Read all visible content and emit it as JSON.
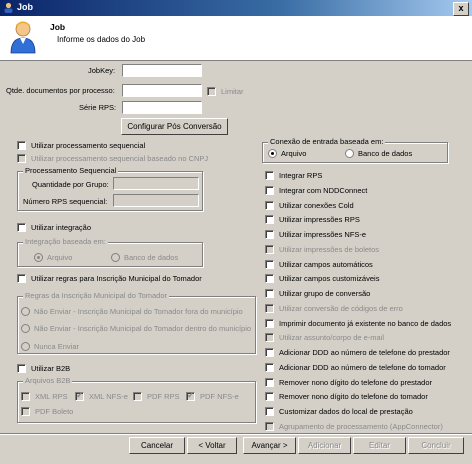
{
  "window": {
    "title": "Job",
    "close_label": "x",
    "title_icon": "user-icon"
  },
  "header": {
    "title": "Job",
    "subtitle": "Informe os dados do Job",
    "icon": "user-avatar-icon"
  },
  "fields": {
    "jobkey_label": "JobKey:",
    "qtd_label": "Qtde. documentos por processo:",
    "limitar_label": "Limitar",
    "serie_label": "Série RPS:",
    "config_button": "Configurar Pós Conversão"
  },
  "left": {
    "proc_seq": "Utilizar processamento sequencial",
    "proc_seq_cnpj": "Utilizar processamento sequencial baseado no CNPJ",
    "grp_proc_seq": "Processamento Sequencial",
    "qtd_grupo": "Quantidade por Grupo:",
    "num_rps_seq": "Número RPS sequencial:",
    "integracao": "Utilizar integração",
    "grp_integracao": "Integração baseada em:",
    "int_arquivo": "Arquivo",
    "int_banco": "Banco de dados",
    "regras_im": "Utilizar regras para Inscrição Municipal do Tomador",
    "grp_regras": "Regras da Inscrição Municipal do Tomador",
    "regra1": "Não Enviar - Inscrição Municipal do Tomador fora do município",
    "regra2": "Não Enviar - Inscrição Municipal do Tomador dentro do município",
    "regra3": "Nunca Enviar",
    "b2b": "Utilizar B2B",
    "grp_b2b": "Arquivos B2B",
    "xml_rps": "XML RPS",
    "xml_nfse": "XML NFS-e",
    "pdf_rps": "PDF RPS",
    "pdf_nfse": "PDF NFS-e",
    "pdf_boleto": "PDF Boleto"
  },
  "right": {
    "grp_conexao": "Conexão de entrada baseada em:",
    "con_arquivo": "Arquivo",
    "con_banco": "Banco de dados",
    "options": [
      "Integrar RPS",
      "Integrar com NDDConnect",
      "Utilizar conexões Cold",
      "Utilizar impressões RPS",
      "Utilizar impressões NFS-e",
      "Utilizar impressões de boletos",
      "Utilizar campos automáticos",
      "Utilizar campos customizáveis",
      "Utilizar grupo de conversão",
      "Utilizar conversão de códigos de erro",
      "Imprimir documento já existente no banco de dados",
      "Utilizar assunto/corpo de e-mail",
      "Adicionar DDD ao número de telefone do prestador",
      "Adicionar DDD ao número de telefone do tomador",
      "Remover nono dígito do telefone do prestador",
      "Remover nono dígito do telefone do tomador",
      "Customizar dados do local de prestação",
      "Agrupamento de processamento (AppConnector)"
    ]
  },
  "buttons": {
    "cancelar": "Cancelar",
    "voltar": "< Voltar",
    "avancar": "Avançar >",
    "adicionar": "Adicionar",
    "editar": "Editar",
    "concluir": "Concluir"
  }
}
